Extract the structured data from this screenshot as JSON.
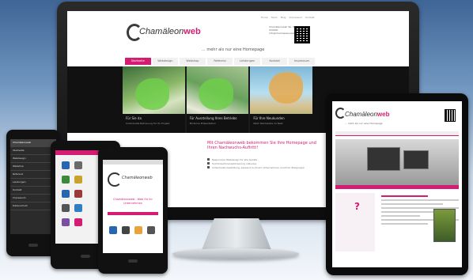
{
  "colors": {
    "accent": "#d41d72",
    "dark": "#111111",
    "bg_top": "#3f6596"
  },
  "monitor": {
    "top_links": [
      "Home",
      "Team",
      "Blog",
      "Impressum",
      "Kontakt"
    ],
    "logo_prefix": "Chamäleon",
    "logo_brand": "web",
    "slogan": "... mehr als nur eine Homepage",
    "contact": "Chamäleonweb Tel. 0000 000000 info@chamaeleonweb",
    "nav": [
      "Startseite",
      "Webdesign",
      "Webshop",
      "Referenz",
      "Leistungen",
      "Kontakt",
      "Impressum"
    ],
    "panels": [
      {
        "title": "Für Sie da",
        "sub": "Individuelle Betreuung für Ihr Projekt"
      },
      {
        "title": "Für Ausstellung Ihres Betriebs",
        "sub": "Moderne Präsentation"
      },
      {
        "title": "Für Ihre Neukunden",
        "sub": "Mehr Reichweite im Netz"
      }
    ],
    "headline": "Mit Chamäleonweb bekommen Sie Ihre Homepage und Ihren Nachwuchs-Auftritt!",
    "bullets": [
      "Responsive Webdesign für alle Geräte",
      "Suchmaschinenoptimierung inklusive",
      "Individuelle Gestaltung, passend zu Ihrem Unternehmen und Ihrer Zielgruppe"
    ]
  },
  "tablet": {
    "logo_prefix": "Chamäleon",
    "logo_brand": "web",
    "slogan": "... mehr als nur eine Homepage"
  },
  "phone1": {
    "title": "Chamäleonweb",
    "menu": [
      "Startseite",
      "Webdesign",
      "Webshop",
      "Referenz",
      "Leistungen",
      "Kontakt",
      "Impressum",
      "Datenschutz"
    ]
  },
  "phone3": {
    "logo": "Chamäleonweb",
    "text": "Chamäleonweb - Web für ihr Unternehmen"
  }
}
